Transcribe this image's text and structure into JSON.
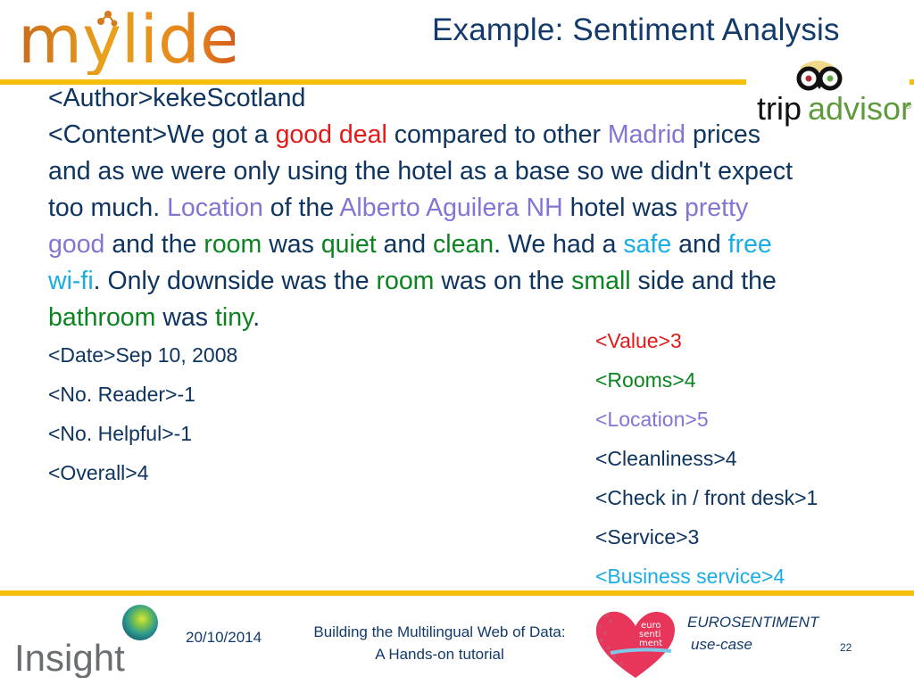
{
  "header": {
    "logo_text": "mylider",
    "title": "Example: Sentiment Analysis",
    "tripadvisor_logo_text_trip": "trip",
    "tripadvisor_logo_text_advisor": "advisor",
    "tripadvisor_registered": "®"
  },
  "review": {
    "author_line": "<Author>kekeScotland",
    "content_segments": [
      {
        "text": "<Content>We got a ",
        "color": "default"
      },
      {
        "text": "good deal",
        "color": "red"
      },
      {
        "text": " compared to other ",
        "color": "default"
      },
      {
        "text": "Madrid",
        "color": "purple"
      },
      {
        "text": " prices",
        "color": "default"
      },
      {
        "text": "\n",
        "color": "break"
      },
      {
        "text": "and as we were only using the hotel as a base so we didn't expect",
        "color": "default"
      },
      {
        "text": "\n",
        "color": "break"
      },
      {
        "text": "too much. ",
        "color": "default"
      },
      {
        "text": "Location",
        "color": "purple"
      },
      {
        "text": " of the ",
        "color": "default"
      },
      {
        "text": "Alberto Aguilera NH",
        "color": "purple"
      },
      {
        "text": " hotel was ",
        "color": "default"
      },
      {
        "text": "pretty",
        "color": "purple"
      },
      {
        "text": "\n",
        "color": "break"
      },
      {
        "text": "good",
        "color": "purple"
      },
      {
        "text": " and the ",
        "color": "default"
      },
      {
        "text": "room",
        "color": "green"
      },
      {
        "text": " was ",
        "color": "default"
      },
      {
        "text": "quiet",
        "color": "green"
      },
      {
        "text": " and ",
        "color": "default"
      },
      {
        "text": "clean",
        "color": "green"
      },
      {
        "text": ". We had a ",
        "color": "default"
      },
      {
        "text": "safe",
        "color": "cyan"
      },
      {
        "text": " and ",
        "color": "default"
      },
      {
        "text": "free",
        "color": "cyan"
      },
      {
        "text": "\n",
        "color": "break"
      },
      {
        "text": "wi-fi",
        "color": "cyan"
      },
      {
        "text": ". Only downside was the ",
        "color": "default"
      },
      {
        "text": "room",
        "color": "green"
      },
      {
        "text": " was on the ",
        "color": "default"
      },
      {
        "text": "small",
        "color": "green"
      },
      {
        "text": " side and the",
        "color": "default"
      },
      {
        "text": "\n",
        "color": "break"
      },
      {
        "text": "bathroom",
        "color": "green"
      },
      {
        "text": " was ",
        "color": "default"
      },
      {
        "text": "tiny",
        "color": "green"
      },
      {
        "text": ".",
        "color": "default"
      }
    ],
    "meta": [
      "<Date>Sep 10, 2008",
      "<No. Reader>-1",
      "<No. Helpful>-1",
      "<Overall>4"
    ],
    "ratings": [
      {
        "text": "<Value>3",
        "color": "#e31919"
      },
      {
        "text": "<Rooms>4",
        "color": "#0b8420"
      },
      {
        "text": "<Location>5",
        "color": "#8275d4"
      },
      {
        "text": "<Cleanliness>4",
        "color": "#0e3460"
      },
      {
        "text": "<Check in / front desk>1",
        "color": "#0e3460"
      },
      {
        "text": "<Service>3",
        "color": "#0e3460"
      },
      {
        "text": "<Business service>4",
        "color": "#19ade6"
      }
    ]
  },
  "footer": {
    "insight_logo_text": "Insight",
    "date": "20/10/2014",
    "title_line1": "Building the Multilingual Web of Data:",
    "title_line2": "A Hands-on tutorial",
    "euro_logo_text": [
      "euro",
      "senti",
      "ment"
    ],
    "eurosentiment_line1": "EUROSENTIMENT",
    "eurosentiment_line2": "use-case",
    "slide_number": "22"
  },
  "colors": {
    "accent_rule": "#f7bf0b",
    "title_blue": "#123a6b",
    "text_navy": "#0e3460",
    "red": "#e31919",
    "purple": "#8275d4",
    "green": "#0b8420",
    "cyan": "#19ade6"
  }
}
